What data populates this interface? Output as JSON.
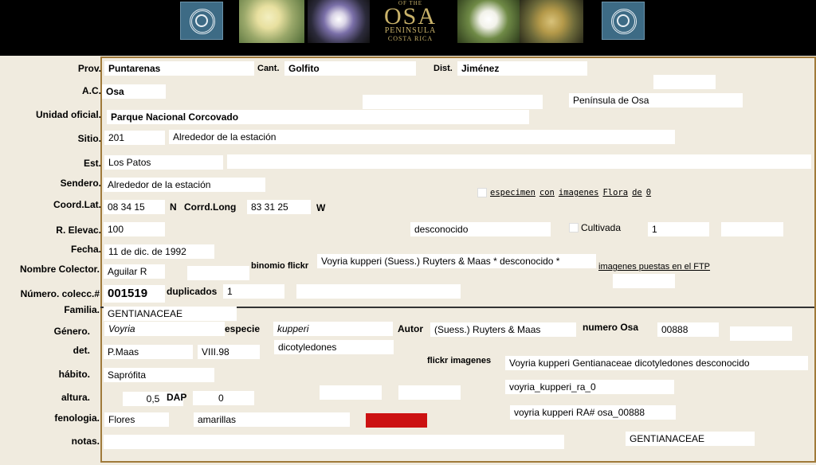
{
  "header": {
    "logo_of_the": "OF THE",
    "logo_osa": "OSA",
    "logo_peninsula": "PENINSULA",
    "logo_costa_rica": "COSTA RICA"
  },
  "labels": {
    "prov": "Prov.",
    "cant": "Cant.",
    "dist": "Dist.",
    "ac": "A.C.",
    "unidad": "Unidad oficial.",
    "sitio": "Sitio.",
    "est": "Est.",
    "sendero": "Sendero.",
    "coord_lat": "Coord.Lat.",
    "n": "N",
    "coord_long": "Corrd.Long",
    "w": "W",
    "elevac": "R. Elevac.",
    "cultivada": "Cultivada",
    "fecha": "Fecha.",
    "colector": "Nombre Colector.",
    "binomio": "binomio flickr",
    "numero": "Número. colecc.#",
    "duplicados": "duplicados",
    "familia": "Familia.",
    "genero": "Género.",
    "especie": "especie",
    "autor": "Autor",
    "numero_osa": "numero Osa",
    "det": "det.",
    "flickr_imagenes": "flickr imagenes",
    "habito": "hábito.",
    "altura": "altura.",
    "dap": "DAP",
    "fenologia": "fenologia.",
    "notas": "notas."
  },
  "values": {
    "prov": "Puntarenas",
    "cant": "Golfito",
    "dist": "Jiménez",
    "ac": "Osa",
    "peninsula": "Península de Osa",
    "unidad": "Parque Nacional Corcovado",
    "sitio_num": "201",
    "sitio_desc": "Alrededor de la estación",
    "est": "Los Patos",
    "sendero": "Alrededor de la estación",
    "lat": "08 34 15",
    "long": "83 31 25",
    "elev": "100",
    "elev_status": "desconocido",
    "cultivada_val": "1",
    "fecha": "11 de dic. de 1992",
    "colector": "Aguilar R",
    "binomio": "Voyria kupperi (Suess.) Ruyters & Maas * desconocido *",
    "numero": "001519",
    "duplicados": "1",
    "familia": "GENTIANACEAE",
    "genero": "Voyria",
    "especie": "kupperi",
    "autor": "(Suess.) Ruyters & Maas",
    "numero_osa": "00888",
    "det": "P.Maas",
    "det_date": "VIII.98",
    "clase": "dicotyledones",
    "flickr_imagenes": "Voyria kupperi Gentianaceae dicotyledones desconocido",
    "habito": "Saprófita",
    "altura": "0,5",
    "dap": "0",
    "img_name": "voyria_kupperi_ra_0",
    "img_code": "voyria kupperi RA# osa_00888",
    "fenologia": "Flores",
    "color": "amarillas",
    "notas_familia": "GENTIANACEAE"
  },
  "links": {
    "specimen_words": [
      "especimen",
      "con",
      "imagenes",
      "Flora",
      "de",
      "0"
    ],
    "ftp": "imagenes puestas en el FTP"
  },
  "colors": {
    "background": "#f0ebdf",
    "border": "#a07a3a",
    "swatch": "#cc1111"
  }
}
